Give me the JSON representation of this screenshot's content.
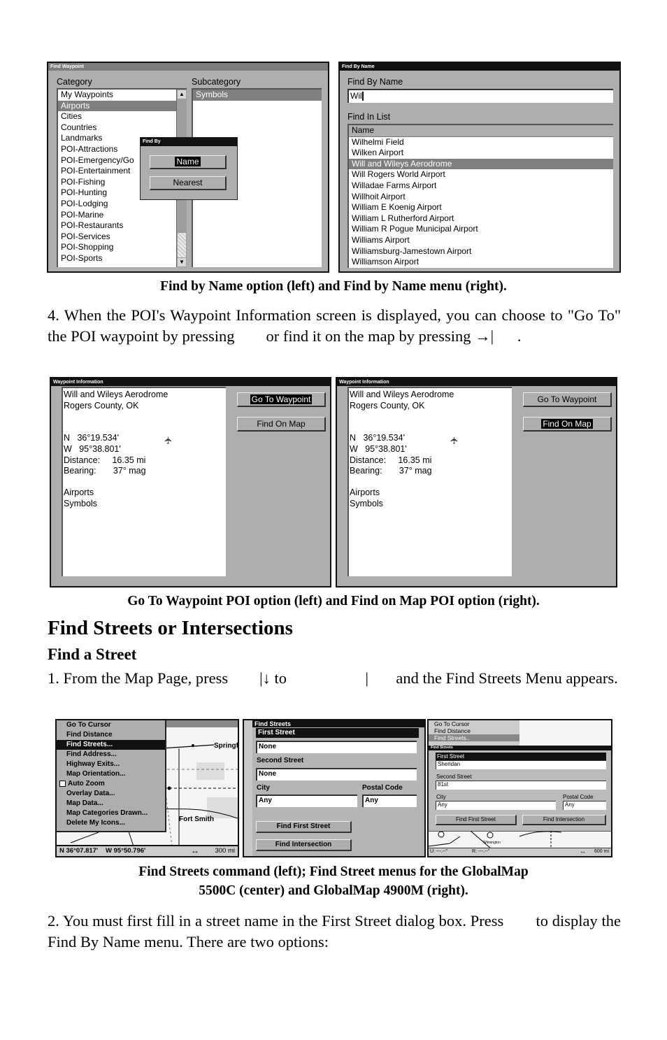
{
  "screens": {
    "find_waypoint": {
      "title": "Find Waypoint",
      "category_label": "Category",
      "subcategory_label": "Subcategory",
      "categories": [
        "My Waypoints",
        "Airports",
        "Cities",
        "Countries",
        "Landmarks",
        "POI-Attractions",
        "POI-Emergency/Go",
        "POI-Entertainment",
        "POI-Fishing",
        "POI-Hunting",
        "POI-Lodging",
        "POI-Marine",
        "POI-Restaurants",
        "POI-Services",
        "POI-Shopping",
        "POI-Sports"
      ],
      "selected_category": "Airports",
      "subcategories": [
        "Symbols"
      ],
      "find_by_dialog": {
        "title": "Find By",
        "name_button": "Name",
        "nearest_button": "Nearest"
      }
    },
    "find_by_name": {
      "title": "Find By Name",
      "name_label": "Find By Name",
      "name_value": "Wil",
      "list_label": "Find In List",
      "column_header": "Name",
      "results": [
        "Wilhelmi Field",
        "Wilken Airport",
        "Will and Wileys Aerodrome",
        "Will Rogers World Airport",
        "Willadae Farms Airport",
        "Willhoit Airport",
        "William E Koenig Airport",
        "William L Rutherford Airport",
        "William R Pogue Municipal Airport",
        "Williams Airport",
        "Williamsburg-Jamestown Airport",
        "Williamson Airport"
      ],
      "selected_result": "Will and Wileys Aerodrome"
    },
    "waypoint_info": {
      "title": "Waypoint Information",
      "name": "Will and Wileys Aerodrome",
      "location": "Rogers County, OK",
      "lat_prefix": "N",
      "lat": "36°19.534'",
      "lon_prefix": "W",
      "lon": "95°38.801'",
      "distance_label": "Distance:",
      "distance": "16.35 mi",
      "bearing_label": "Bearing:",
      "bearing": "37° mag",
      "category": "Airports",
      "subcategory": "Symbols",
      "go_to_button": "Go To Waypoint",
      "find_on_map_button": "Find On Map",
      "icon": "airplane-icon"
    },
    "map_menu": {
      "items": [
        "Go To Cursor",
        "Find Distance",
        "Find Streets...",
        "Find Address...",
        "Highway Exits...",
        "Map Orientation...",
        "Auto Zoom",
        "Overlay Data...",
        "Map Data...",
        "Map Categories Drawn...",
        "Delete My Icons..."
      ],
      "selected": "Find Streets...",
      "checkbox_item": "Auto Zoom",
      "map_labels": [
        "Springf",
        "Fort Smith"
      ],
      "status_lat": "N  36°07.817'",
      "status_lon": "W  95°50.796'",
      "scale": "300 mi"
    },
    "find_streets_5500c": {
      "title": "Find Streets",
      "first_street_label": "First Street",
      "first_street_value": "None",
      "second_street_label": "Second Street",
      "second_street_value": "None",
      "city_label": "City",
      "city_value": "Any",
      "postal_label": "Postal Code",
      "postal_value": "Any",
      "find_first_button": "Find First Street",
      "find_intersection_button": "Find Intersection"
    },
    "find_streets_4900m": {
      "menu_items": [
        "Go To Cursor",
        "Find Distance",
        "Find Streets.."
      ],
      "title": "Find Streets",
      "first_street_label": "First Street",
      "first_street_value": "Sheridan",
      "second_street_label": "Second Street",
      "second_street_value": "81st",
      "city_label": "City",
      "city_value": "Any",
      "postal_label": "Postal Code",
      "postal_value": "Any",
      "find_first_button": "Find First Street",
      "find_intersection_button": "Find Intersection",
      "map_label": "Wilmington",
      "status_u": "U:  ---.--\"",
      "status_r": "R:  ---.--\"",
      "scale": "600 mi"
    }
  },
  "text": {
    "caption1": "Find by Name option (left) and Find by Name menu (right).",
    "para4": "4. When the POI's Waypoint Information screen is displayed, you can choose to \"Go To\" the POI waypoint by pressing        or find it on the map by pressing →|      .",
    "caption2": "Go To Waypoint POI option (left) and Find on Map POI option (right).",
    "heading": "Find Streets or Intersections",
    "subheading": "Find a Street",
    "para1": "1. From the Map Page, press        |↓ to                    |       and the Find Streets Menu appears.",
    "caption3_line1": "Find Streets command (left); Find Street menus for the GlobalMap",
    "caption3_line2": "5500C (center) and GlobalMap 4900M (right).",
    "para2": "2. You must first fill in a street name in the First Street dialog box. Press        to display the Find By Name menu. There are two options:"
  }
}
